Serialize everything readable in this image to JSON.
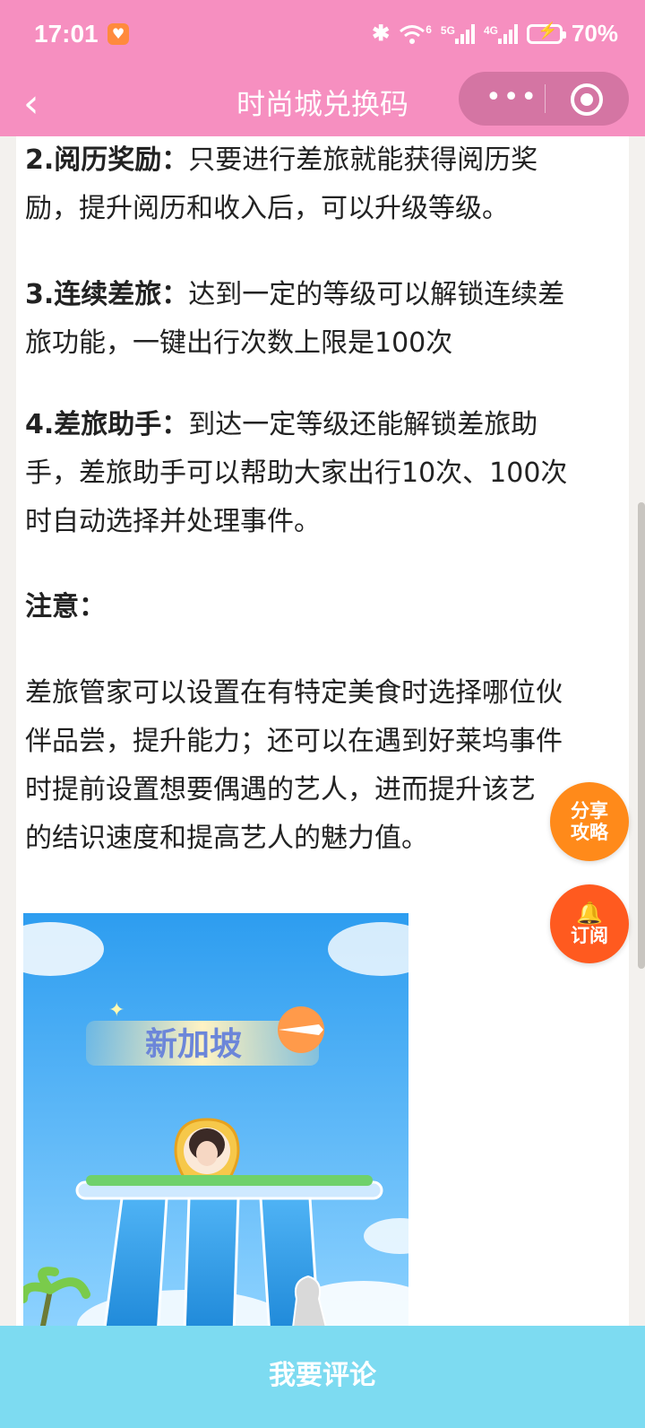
{
  "status": {
    "time": "17:01",
    "battery": "70%",
    "net1": "6",
    "net2": "5G",
    "net3": "4G"
  },
  "nav": {
    "back_glyph": "‹",
    "title": "时尚城兑换码",
    "more_glyph": "•••"
  },
  "article": {
    "p2_head": "2.阅历奖励：",
    "p2_line1_rest": "只要进行差旅就能获得阅历奖",
    "p2_line2": "励，提升阅历和收入后，可以升级等级。",
    "p3_head": "3.连续差旅：",
    "p3_line1_rest": "达到一定的等级可以解锁连续差",
    "p3_line2": "旅功能，一键出行次数上限是100次",
    "p4_head": "4.差旅助手：",
    "p4_line1_rest": "到达一定等级还能解锁差旅助",
    "p4_line2": "手，差旅助手可以帮助大家出行10次、100次",
    "p4_line3": "时自动选择并处理事件。",
    "note_head": "注意：",
    "note_line1": "差旅管家可以设置在有特定美食时选择哪位伙",
    "note_line2": "伴品尝，提升能力；还可以在遇到好莱坞事件",
    "note_line3": "时提前设置想要偶遇的艺人，进而提升该艺",
    "note_line4": "的结识速度和提高艺人的魅力值。"
  },
  "illustration": {
    "banner_text": "新加坡"
  },
  "floating": {
    "share_line1": "分享",
    "share_line2": "攻略",
    "subscribe": "订阅"
  },
  "bottom": {
    "comment_label": "我要评论"
  },
  "colors": {
    "header": "#f68fc0",
    "comment_bar": "#7ddbf1",
    "share": "#ff8a1a",
    "subscribe": "#ff5a1f"
  }
}
